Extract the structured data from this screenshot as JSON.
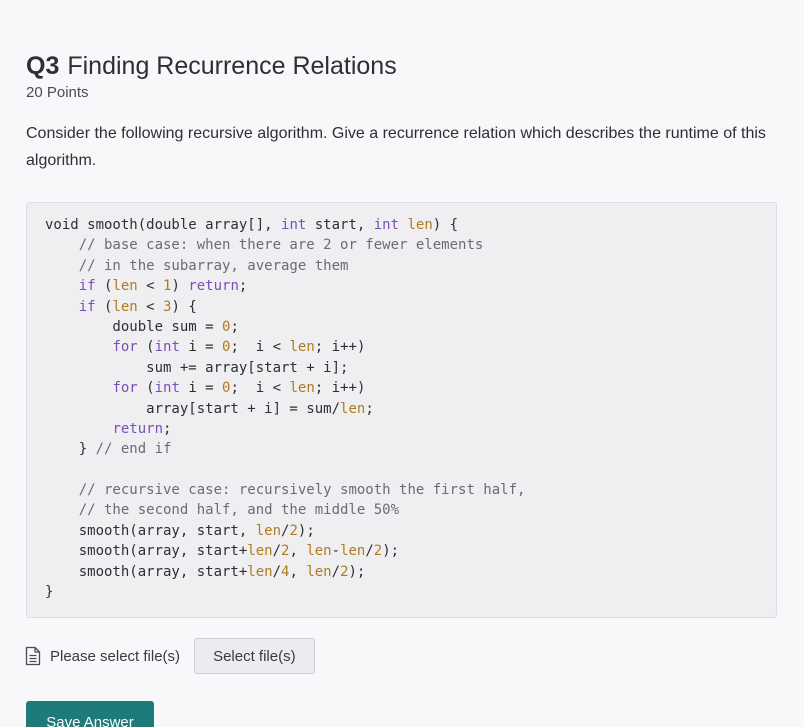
{
  "question": {
    "number": "Q3",
    "title": "Finding Recurrence Relations",
    "points": "20 Points",
    "prompt": "Consider the following recursive algorithm.  Give a recurrence relation which describes the runtime of this algorithm."
  },
  "code": {
    "lines": [
      [
        {
          "t": "void smooth(double array[], "
        },
        {
          "t": "int",
          "c": "kw"
        },
        {
          "t": " start, "
        },
        {
          "t": "int",
          "c": "kw"
        },
        {
          "t": " "
        },
        {
          "t": "len",
          "c": "var"
        },
        {
          "t": ") {"
        }
      ],
      [
        {
          "t": "    "
        },
        {
          "t": "// base case: when there are 2 or fewer elements",
          "c": "cm"
        }
      ],
      [
        {
          "t": "    "
        },
        {
          "t": "// in the subarray, average them",
          "c": "cm"
        }
      ],
      [
        {
          "t": "    "
        },
        {
          "t": "if",
          "c": "kw"
        },
        {
          "t": " ("
        },
        {
          "t": "len",
          "c": "var"
        },
        {
          "t": " < "
        },
        {
          "t": "1",
          "c": "num"
        },
        {
          "t": ") "
        },
        {
          "t": "return",
          "c": "kw"
        },
        {
          "t": ";"
        }
      ],
      [
        {
          "t": "    "
        },
        {
          "t": "if",
          "c": "kw"
        },
        {
          "t": " ("
        },
        {
          "t": "len",
          "c": "var"
        },
        {
          "t": " < "
        },
        {
          "t": "3",
          "c": "num"
        },
        {
          "t": ") {"
        }
      ],
      [
        {
          "t": "        double sum = "
        },
        {
          "t": "0",
          "c": "num"
        },
        {
          "t": ";"
        }
      ],
      [
        {
          "t": "        "
        },
        {
          "t": "for",
          "c": "kw"
        },
        {
          "t": " ("
        },
        {
          "t": "int",
          "c": "kw"
        },
        {
          "t": " i = "
        },
        {
          "t": "0",
          "c": "num"
        },
        {
          "t": ";  i < "
        },
        {
          "t": "len",
          "c": "var"
        },
        {
          "t": "; i++)"
        }
      ],
      [
        {
          "t": "            sum += array[start + i];"
        }
      ],
      [
        {
          "t": "        "
        },
        {
          "t": "for",
          "c": "kw"
        },
        {
          "t": " ("
        },
        {
          "t": "int",
          "c": "kw"
        },
        {
          "t": " i = "
        },
        {
          "t": "0",
          "c": "num"
        },
        {
          "t": ";  i < "
        },
        {
          "t": "len",
          "c": "var"
        },
        {
          "t": "; i++)"
        }
      ],
      [
        {
          "t": "            array[start + i] = sum/"
        },
        {
          "t": "len",
          "c": "var"
        },
        {
          "t": ";"
        }
      ],
      [
        {
          "t": "        "
        },
        {
          "t": "return",
          "c": "kw"
        },
        {
          "t": ";"
        }
      ],
      [
        {
          "t": "    } "
        },
        {
          "t": "// end if",
          "c": "cm"
        }
      ],
      [
        {
          "t": ""
        }
      ],
      [
        {
          "t": "    "
        },
        {
          "t": "// recursive case: recursively smooth the first half,",
          "c": "cm"
        }
      ],
      [
        {
          "t": "    "
        },
        {
          "t": "// the second half, and the middle 50%",
          "c": "cm"
        }
      ],
      [
        {
          "t": "    smooth(array, start, "
        },
        {
          "t": "len",
          "c": "var"
        },
        {
          "t": "/"
        },
        {
          "t": "2",
          "c": "num"
        },
        {
          "t": ");"
        }
      ],
      [
        {
          "t": "    smooth(array, start+"
        },
        {
          "t": "len",
          "c": "var"
        },
        {
          "t": "/"
        },
        {
          "t": "2",
          "c": "num"
        },
        {
          "t": ", "
        },
        {
          "t": "len",
          "c": "var"
        },
        {
          "t": "-"
        },
        {
          "t": "len",
          "c": "var"
        },
        {
          "t": "/"
        },
        {
          "t": "2",
          "c": "num"
        },
        {
          "t": ");"
        }
      ],
      [
        {
          "t": "    smooth(array, start+"
        },
        {
          "t": "len",
          "c": "var"
        },
        {
          "t": "/"
        },
        {
          "t": "4",
          "c": "num"
        },
        {
          "t": ", "
        },
        {
          "t": "len",
          "c": "var"
        },
        {
          "t": "/"
        },
        {
          "t": "2",
          "c": "num"
        },
        {
          "t": ");"
        }
      ],
      [
        {
          "t": "}"
        }
      ]
    ]
  },
  "upload": {
    "icon": "file-text-icon",
    "label": "Please select file(s)",
    "button_label": "Select file(s)"
  },
  "actions": {
    "save_label": "Save Answer"
  },
  "colors": {
    "accent": "#1f7b79",
    "keyword": "#7a4fb8",
    "variable": "#b07a20",
    "comment": "#6b6b73",
    "code_background": "#efeff2"
  }
}
